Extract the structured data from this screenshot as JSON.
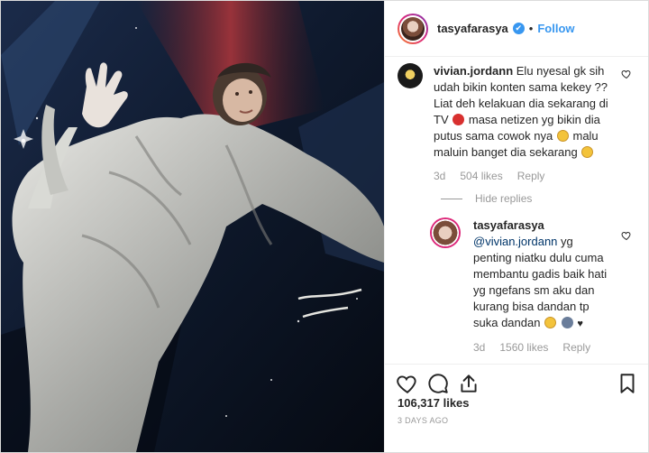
{
  "post": {
    "username": "tasyafarasya",
    "follow_label": "Follow",
    "dot": "•",
    "verified_icon": "✔",
    "likes_text": "106,317 likes",
    "date_text": "3 DAYS AGO"
  },
  "comments": [
    {
      "username": "vivian.jordann",
      "text_1": "Elu nyesal gk sih udah bikin konten sama kekey ?? Liat deh kelakuan dia sekarang di TV",
      "text_2": "masa netizen yg bikin dia putus sama cowok nya",
      "text_3": "malu maluin banget dia sekarang",
      "time": "3d",
      "likes": "504 likes",
      "reply_label": "Reply"
    }
  ],
  "hide_replies_label": "Hide replies",
  "replies": [
    {
      "username": "tasyafarasya",
      "mention": "@vivian.jordann",
      "text": "yg penting niatku dulu cuma membantu gadis baik hati yg ngefans sm aku dan kurang bisa dandan tp suka dandan",
      "time": "3d",
      "likes": "1560 likes",
      "reply_label": "Reply"
    }
  ],
  "icons": {
    "like": "heart-icon",
    "comment": "comment-icon",
    "share": "share-icon",
    "save": "bookmark-icon"
  },
  "colors": {
    "accent": "#3897f0",
    "muted": "#999999",
    "text": "#262626"
  }
}
